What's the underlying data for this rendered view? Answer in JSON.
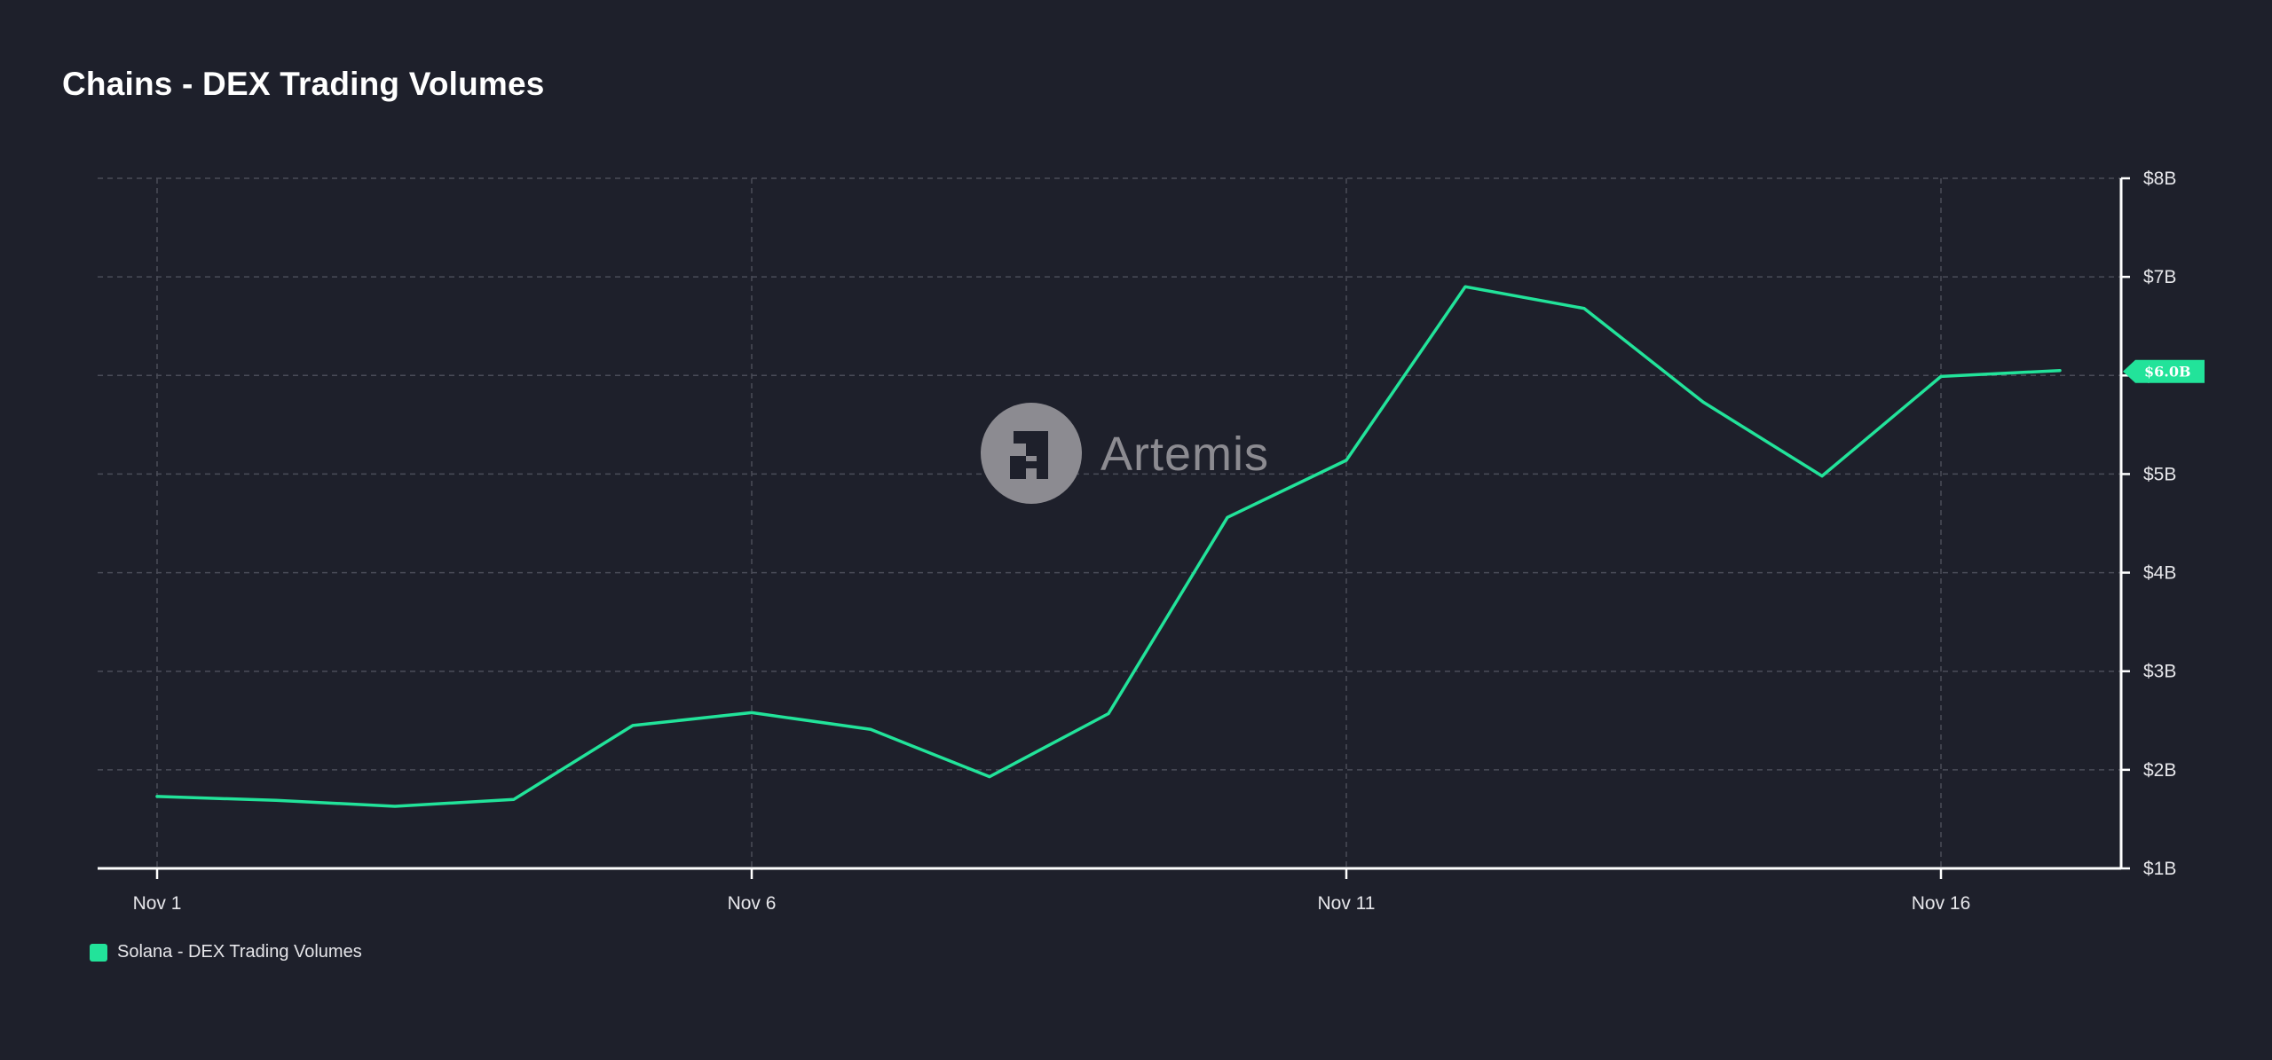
{
  "header": {
    "title": "Chains - DEX Trading Volumes"
  },
  "watermark": {
    "text": "Artemis",
    "icon": "artemis-logo-icon"
  },
  "colors": {
    "background": "#1e202b",
    "series": "#22e39a",
    "grid": "#4a4c58",
    "watermark": "#8c8b91"
  },
  "chart_data": {
    "type": "line",
    "x": [
      "Nov 1",
      "Nov 2",
      "Nov 3",
      "Nov 4",
      "Nov 5",
      "Nov 6",
      "Nov 7",
      "Nov 8",
      "Nov 9",
      "Nov 10",
      "Nov 11",
      "Nov 12",
      "Nov 13",
      "Nov 14",
      "Nov 15",
      "Nov 16",
      "Nov 17"
    ],
    "series": [
      {
        "name": "Solana - DEX Trading Volumes",
        "values": [
          1.73,
          1.69,
          1.63,
          1.7,
          2.45,
          2.58,
          2.41,
          1.93,
          2.57,
          4.56,
          5.14,
          6.9,
          6.68,
          5.73,
          4.98,
          5.99,
          6.05
        ]
      }
    ],
    "x_tick_labels": [
      "Nov 1",
      "Nov 6",
      "Nov 11",
      "Nov 16"
    ],
    "y_tick_labels": [
      "$8B",
      "$7B",
      "$6B",
      "$5B",
      "$4B",
      "$3B",
      "$2B",
      "$1B"
    ],
    "ylim": [
      1,
      8
    ],
    "y_unit": "billions USD",
    "y_axis_position": "right",
    "grid": true,
    "legend_position": "bottom-left",
    "last_value_label": "$6.0B"
  }
}
